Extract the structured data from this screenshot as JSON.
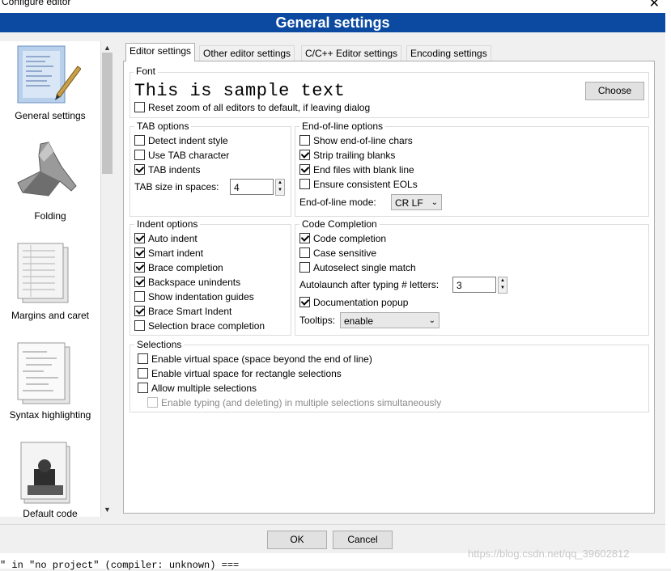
{
  "window": {
    "title": "Configure editor",
    "close_glyph": "✕"
  },
  "header": {
    "title": "General settings"
  },
  "sidebar": {
    "items": [
      {
        "label": "General settings",
        "icon": "general-settings-icon"
      },
      {
        "label": "Folding",
        "icon": "folding-icon"
      },
      {
        "label": "Margins and caret",
        "icon": "margins-icon"
      },
      {
        "label": "Syntax highlighting",
        "icon": "syntax-icon"
      },
      {
        "label": "Default code",
        "icon": "default-code-icon"
      }
    ]
  },
  "tabs": [
    "Editor settings",
    "Other editor settings",
    "C/C++ Editor settings",
    "Encoding settings"
  ],
  "font": {
    "group": "Font",
    "sample": "This is sample text",
    "choose": "Choose",
    "reset_zoom": "Reset zoom of all editors to default, if leaving dialog"
  },
  "tab_options": {
    "group": "TAB options",
    "detect_indent": "Detect indent style",
    "use_tab": "Use TAB character",
    "tab_indents": "TAB indents",
    "tab_size_label": "TAB size in spaces:",
    "tab_size": "4"
  },
  "eol": {
    "group": "End-of-line options",
    "show_eol": "Show end-of-line chars",
    "strip": "Strip trailing blanks",
    "end_blank": "End files with blank line",
    "consistent": "Ensure consistent EOLs",
    "mode_label": "End-of-line mode:",
    "mode": "CR LF"
  },
  "indent": {
    "group": "Indent options",
    "auto": "Auto indent",
    "smart": "Smart indent",
    "brace": "Brace completion",
    "backspace": "Backspace unindents",
    "guides": "Show indentation guides",
    "brace_smart": "Brace Smart Indent",
    "selection_brace": "Selection brace completion"
  },
  "code_completion": {
    "group": "Code Completion",
    "code_completion": "Code completion",
    "case_sensitive": "Case sensitive",
    "autoselect": "Autoselect single match",
    "autolaunch_label": "Autolaunch after typing # letters:",
    "autolaunch": "3",
    "doc_popup": "Documentation popup",
    "tooltips_label": "Tooltips:",
    "tooltips": "enable"
  },
  "selections": {
    "group": "Selections",
    "virtual_space": "Enable virtual space (space beyond the end of line)",
    "virtual_rect": "Enable virtual space for rectangle selections",
    "multiple": "Allow multiple selections",
    "typing_multiple": "Enable typing (and deleting) in multiple selections simultaneously"
  },
  "buttons": {
    "ok": "OK",
    "cancel": "Cancel"
  },
  "console": {
    "text": "\" in \"no project\" (compiler: unknown) ==="
  },
  "watermark": "https://blog.csdn.net/qq_39602812",
  "colors": {
    "header_bg": "#0b4aa0",
    "dialog_bg": "#f0f0f0"
  }
}
